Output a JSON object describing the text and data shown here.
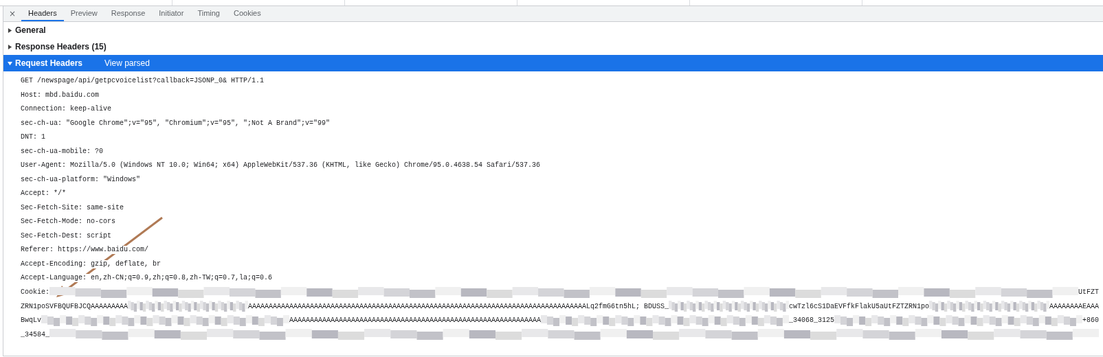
{
  "close_glyph": "×",
  "tabs": [
    {
      "label": "Headers",
      "selected": true
    },
    {
      "label": "Preview",
      "selected": false
    },
    {
      "label": "Response",
      "selected": false
    },
    {
      "label": "Initiator",
      "selected": false
    },
    {
      "label": "Timing",
      "selected": false
    },
    {
      "label": "Cookies",
      "selected": false
    }
  ],
  "sections": [
    {
      "title": "General",
      "expanded": false
    },
    {
      "title": "Response Headers (15)",
      "expanded": false
    },
    {
      "title": "Request Headers",
      "expanded": true,
      "link": "View parsed"
    }
  ],
  "request_lines": [
    "GET /newspage/api/getpcvoicelist?callback=JSONP_0& HTTP/1.1",
    "Host: mbd.baidu.com",
    "Connection: keep-alive",
    "sec-ch-ua: \"Google Chrome\";v=\"95\", \"Chromium\";v=\"95\", \";Not A Brand\";v=\"99\"",
    "DNT: 1",
    "sec-ch-ua-mobile: ?0",
    "User-Agent: Mozilla/5.0 (Windows NT 10.0; Win64; x64) AppleWebKit/537.36 (KHTML, like Gecko) Chrome/95.0.4638.54 Safari/537.36",
    "sec-ch-ua-platform: \"Windows\"",
    "Accept: */*",
    "Sec-Fetch-Site: same-site",
    "Sec-Fetch-Mode: no-cors",
    "Sec-Fetch-Dest: script",
    "Referer: https://www.baidu.com/",
    "Accept-Encoding: gzip, deflate, br",
    "Accept-Language: en,zh-CN;q=0.9,zh;q=0.8,zh-TW;q=0.7,la;q=0.6"
  ],
  "cookie_lines": [
    [
      {
        "kind": "text",
        "text": "Cookie:"
      },
      {
        "kind": "redacted"
      },
      {
        "kind": "text",
        "text": "UtFZT"
      }
    ],
    [
      {
        "kind": "text",
        "text": "ZRN1poSVFBQUFBJCQAAAAAAAAA"
      },
      {
        "kind": "redacted"
      },
      {
        "kind": "text",
        "text": "AAAAAAAAAAAAAAAAAAAAAAAAAAAAAAAAAAAAAAAAAAAAAAAAAAAAAAAAAAAAAAAAAAAAAAAAAAAAAAAAAALq2fmG6tn5hL; BDUSS_"
      },
      {
        "kind": "redacted"
      },
      {
        "kind": "text",
        "text": "cwTzl6cS1DaEVFfkFlakU5aUtFZTZRN1po"
      },
      {
        "kind": "redacted"
      },
      {
        "kind": "text",
        "text": "AAAAAAAAEAAA"
      }
    ],
    [
      {
        "kind": "text",
        "text": "BwqLv"
      },
      {
        "kind": "redacted"
      },
      {
        "kind": "text",
        "text": "AAAAAAAAAAAAAAAAAAAAAAAAAAAAAAAAAAAAAAAAAAAAAAAAAAAAAAAAAAAAA"
      },
      {
        "kind": "redacted"
      },
      {
        "kind": "text",
        "text": "_34068_3125"
      },
      {
        "kind": "redacted"
      },
      {
        "kind": "text",
        "text": "+860"
      }
    ],
    [
      {
        "kind": "text",
        "text": "_34584_"
      },
      {
        "kind": "redacted"
      }
    ]
  ]
}
